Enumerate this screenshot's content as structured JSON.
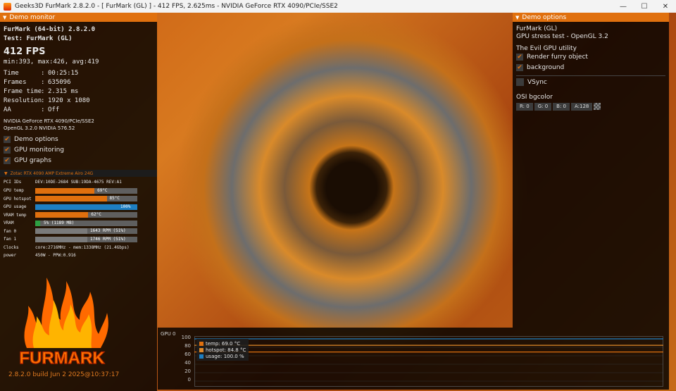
{
  "window": {
    "title": "Geeks3D FurMark 2.8.2.0 - [ FurMark (GL) ] - 412 FPS, 2.625ms - NVIDIA GeForce RTX 4090/PCIe/SSE2",
    "minimize": "—",
    "maximize": "☐",
    "close": "✕"
  },
  "demo_monitor": {
    "header": "Demo monitor",
    "app_name": "FurMark (64-bit) 2.8.2.0",
    "test": "Test: FurMark (GL)",
    "fps": "412 FPS",
    "fps_stats": "min:393, max:426, avg:419",
    "stats": [
      {
        "label": "Time",
        "value": "00:25:15"
      },
      {
        "label": "Frames",
        "value": "635096"
      },
      {
        "label": "Frame time",
        "value": "2.315 ms"
      },
      {
        "label": "Resolution",
        "value": "1920 x 1080"
      },
      {
        "label": "AA",
        "value": "Off"
      }
    ],
    "renderer": "NVIDIA GeForce RTX 4090/PCIe/SSE2",
    "opengl": "OpenGL 3.2.0 NVIDIA 576.52",
    "checkboxes": [
      {
        "label": "Demo options",
        "checked": true
      },
      {
        "label": "GPU monitoring",
        "checked": true
      },
      {
        "label": "GPU graphs",
        "checked": true
      }
    ],
    "check_glyph": "✔"
  },
  "gpu_monitor": {
    "header": "Zotac RTX 4090 AMP Extreme Airo 24G",
    "pci_label": "PCI IDs",
    "pci_value": "DEV:10DE-2684 SUB:19DA-4675 REV:A1",
    "bars": [
      {
        "label": "GPU temp",
        "text": "69°C",
        "fraction": 0.58,
        "color": "#e0700e"
      },
      {
        "label": "GPU hotspot",
        "text": "85°C",
        "fraction": 0.7,
        "color": "#e0700e"
      },
      {
        "label": "GPU usage",
        "text": "100%",
        "fraction": 1.0,
        "color": "#1e7fc2"
      },
      {
        "label": "VRAM temp",
        "text": "62°C",
        "fraction": 0.52,
        "color": "#e0700e"
      },
      {
        "label": "VRAM",
        "text": "5% (1189 MB)",
        "fraction": 0.05,
        "color": "#2ea043"
      },
      {
        "label": "fan 0",
        "text": "1643 RPM (51%)",
        "fraction": 0.51,
        "color": "#7a7a7a"
      },
      {
        "label": "fan 1",
        "text": "1746 RPM (51%)",
        "fraction": 0.51,
        "color": "#7a7a7a"
      }
    ],
    "clocks_label": "Clocks",
    "clocks_value": "core:2716MHz - mem:1338MHz (21.4Gbps)",
    "power_label": "power",
    "power_value": "450W - PPW:0.916"
  },
  "logo_text": "FURMARK",
  "build": "2.8.2.0 build Jun  2 2025@10:37:17",
  "graph": {
    "title": "GPU 0",
    "ticks": [
      "100",
      "80",
      "60",
      "40",
      "20",
      "0"
    ],
    "legend": [
      {
        "label": "temp: 69.0 °C",
        "color": "#e0700e"
      },
      {
        "label": "hotspot: 84.8 °C",
        "color": "#e08a2a"
      },
      {
        "label": "usage: 100.0 %",
        "color": "#1e7fc2"
      }
    ],
    "series": [
      {
        "name": "temp",
        "value": 69.0
      },
      {
        "name": "hotspot",
        "value": 84.8
      },
      {
        "name": "usage",
        "value": 100.0
      }
    ]
  },
  "demo_options": {
    "header": "Demo options",
    "name": "FurMark (GL)",
    "desc": "GPU stress test - OpenGL 3.2",
    "utility": "The Evil GPU utility",
    "checks": [
      {
        "label": "Render furry object",
        "checked": true
      },
      {
        "label": "background",
        "checked": true
      }
    ],
    "vsync": {
      "label": "VSync",
      "checked": false
    },
    "osi_label": "OSI bgcolor",
    "color": [
      {
        "label": "R:  0"
      },
      {
        "label": "G:  0"
      },
      {
        "label": "B:  0"
      },
      {
        "label": "A:128"
      }
    ]
  }
}
